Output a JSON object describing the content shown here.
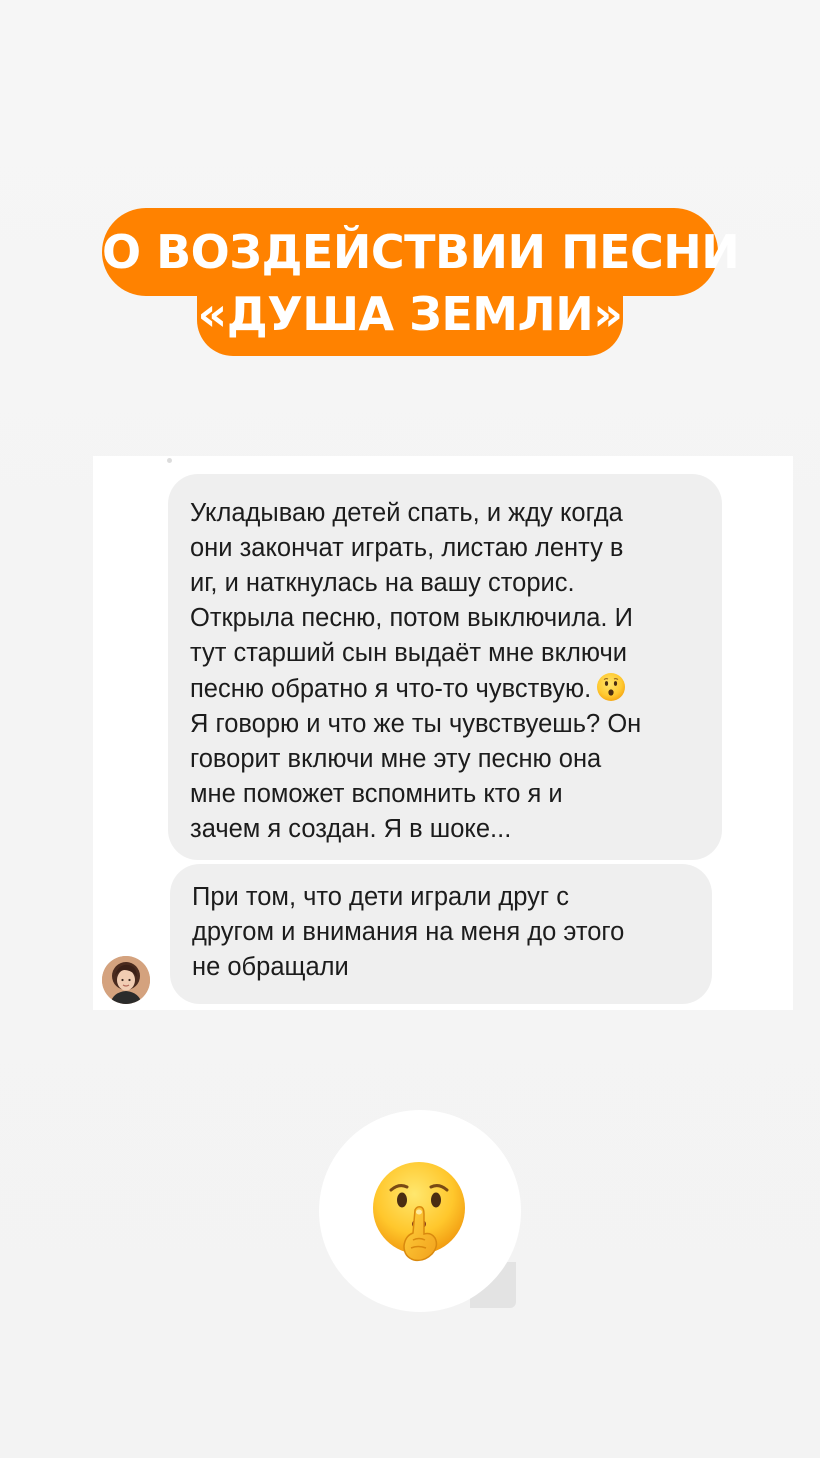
{
  "title": {
    "line1": "О ВОЗДЕЙСТВИИ ПЕСНИ",
    "line2": "«ДУША ЗЕМЛИ»"
  },
  "chat": {
    "messages": [
      {
        "text": "Укладываю детей спать, и жду когда\nони закончат играть, листаю ленту в\nиг, и наткнулась на вашу сторис.\nОткрыла песню, потом выключила. И\nтут старший сын выдаёт мне включи\nпесню обратно я что-то чувствую.",
        "text_after_emoji": "\nЯ говорю и что же ты чувствуешь? Он\nговорит включи мне эту песню она\nмне поможет вспомнить кто я и\nзачем я создан. Я в шоке...",
        "emoji": "hushed-face"
      },
      {
        "text": "При том, что дети играли друг с\nдругом и внимания на меня до этого\nне обращали"
      }
    ],
    "avatar": "sender-avatar"
  },
  "sticker": {
    "emoji": "shushing-face"
  },
  "colors": {
    "accent": "#ff8200",
    "bubble": "#efefef",
    "background": "#f5f5f5"
  }
}
